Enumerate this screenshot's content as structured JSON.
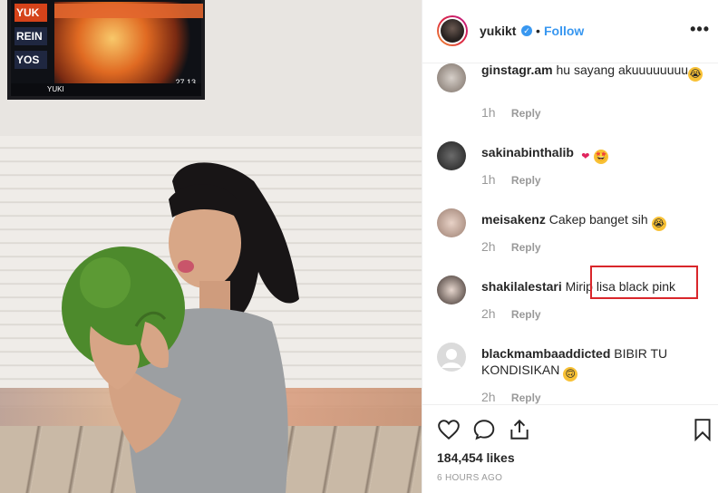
{
  "scoreboard": {
    "players": [
      "YUK",
      "REIN",
      "YOS"
    ],
    "score": "27.13",
    "footer_name": "YUKI"
  },
  "post": {
    "username": "yukikt",
    "verified_icon": "verified-badge-icon",
    "separator": "•",
    "follow_label": "Follow",
    "more_label": "•••"
  },
  "comments": [
    {
      "user": "ginstagr.am",
      "text": "hu sayang akuuuuuuuu",
      "emoji": "crying-face",
      "time": "1h",
      "reply": "Reply"
    },
    {
      "user": "sakinabinthalib",
      "text": "",
      "emoji": "heart, star-struck",
      "time": "1h",
      "reply": "Reply"
    },
    {
      "user": "meisakenz",
      "text": "Cakep banget sih",
      "emoji": "crying-face",
      "time": "2h",
      "reply": "Reply"
    },
    {
      "user": "shakilalestari",
      "text": "Mirip lisa black pink",
      "emoji": "",
      "time": "2h",
      "reply": "Reply"
    },
    {
      "user": "blackmambaaddicted",
      "text": "BIBIR TU KONDISIKAN",
      "emoji": "upside-down-face",
      "time": "2h",
      "reply": "Reply"
    }
  ],
  "footer": {
    "likes": "184,454 likes",
    "time_ago": "6 HOURS AGO"
  },
  "colors": {
    "accent": "#3897f0",
    "highlight": "#d9262b",
    "muted": "#999999"
  }
}
